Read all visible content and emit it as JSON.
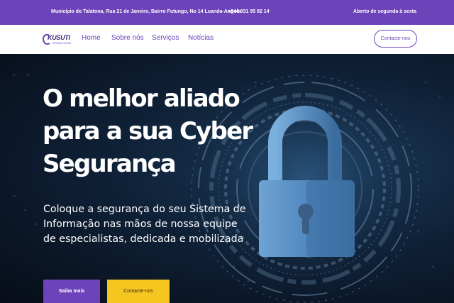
{
  "topbar": {
    "address": "Município do Talatona, Rua 21 de Janeiro, Bairro Futungo, No 14 Luanda-Angola",
    "phone": "+244 931 95 82 14",
    "hours": "Aberto de segunda à sexta"
  },
  "brand": {
    "name": "KUSUTI",
    "tagline": "TECNOLOGIAS",
    "color": "#6c43b8"
  },
  "nav": {
    "links": [
      "Home",
      "Sobre nós",
      "Serviços",
      "Notícias"
    ],
    "cta": "Contacte-nos"
  },
  "hero": {
    "title": "O melhor aliado para a sua Cyber Segurança",
    "subtitle": "Coloque a segurança do seu Sistema de Informação nas mãos de nossa equipe de especialistas, dedicada e mobilizada",
    "primary_button": "Saiba mais",
    "secondary_button": "Contacte-nos",
    "image_icon": "padlock-icon"
  },
  "colors": {
    "accent": "#6c43b8",
    "button_yellow": "#f5c61f",
    "hero_background": "#0f2137"
  }
}
